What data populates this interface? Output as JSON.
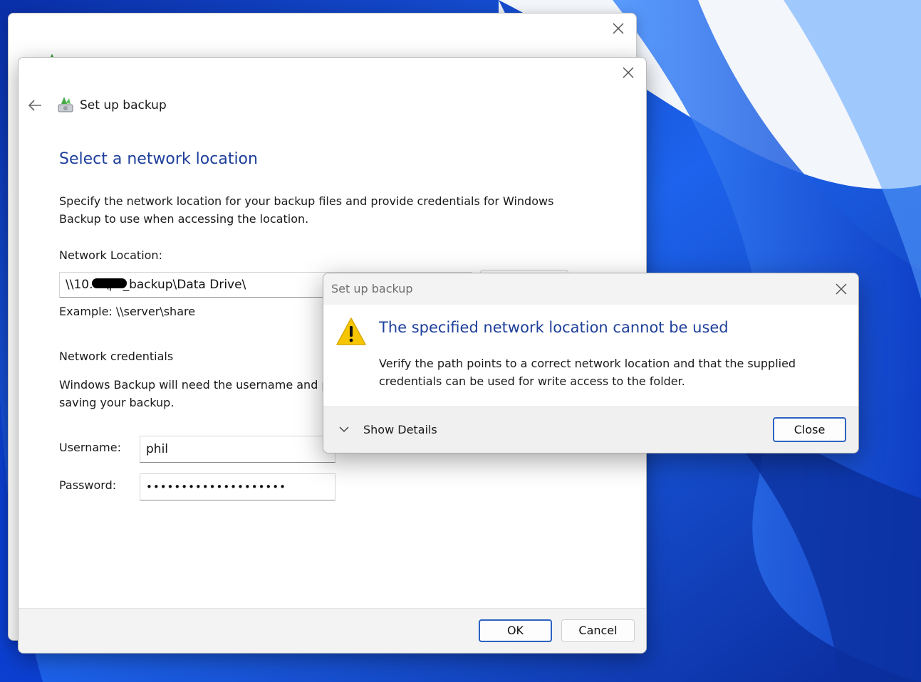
{
  "colors": {
    "accent_blue": "#1e3f9a",
    "default_button_border": "#2b62c2",
    "wallpaper": "#1550d8",
    "warning_yellow": "#f7c600"
  },
  "main_window": {
    "title": "Set up backup",
    "heading": "Select a network location",
    "description": "Specify the network location for your backup files and provide credentials for Windows Backup to use when accessing the location.",
    "network_location_label": "Network Location:",
    "network_location_value": "\\\\10.        2\\pc_backup\\Data Drive\\",
    "example_text": "Example: \\\\server\\share",
    "credentials_heading": "Network credentials",
    "credentials_description": "Windows Backup will need the username and p",
    "credentials_description_2": "saving your backup.",
    "username_label": "Username:",
    "username_value": "phil",
    "password_label": "Password:",
    "password_value": "••••••••••••••••••••",
    "ok_label": "OK",
    "cancel_label": "Cancel"
  },
  "error_dialog": {
    "title": "Set up backup",
    "heading": "The specified network location cannot be used",
    "body": "Verify the path points to a correct network location and that the supplied credentials can be used for write access to the folder.",
    "show_details_label": "Show Details",
    "close_label": "Close"
  },
  "icons": {
    "close": "close-x-icon",
    "back": "back-arrow-icon",
    "app": "backup-drive-icon",
    "warning": "warning-triangle-icon",
    "chevron": "chevron-down-icon"
  }
}
